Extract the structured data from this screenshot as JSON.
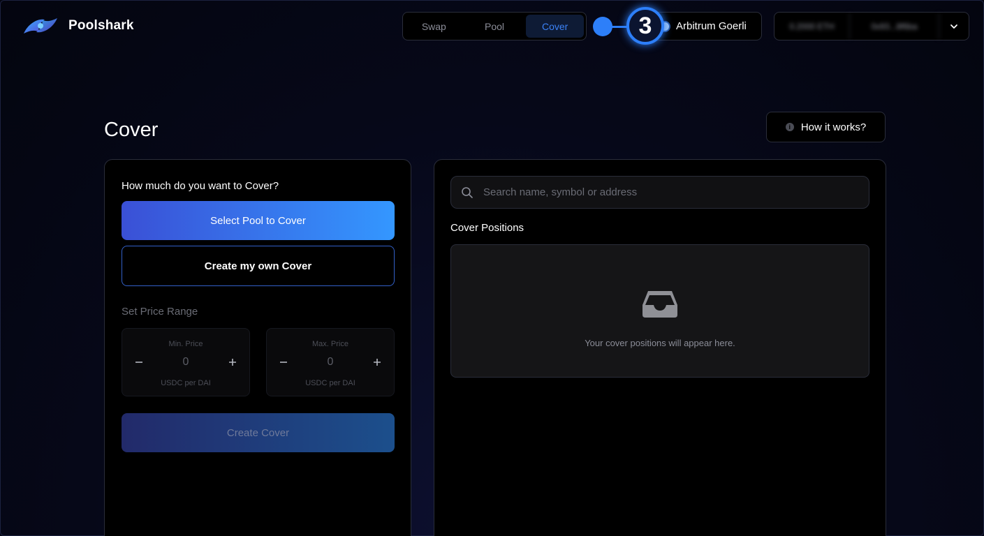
{
  "app": {
    "name": "Poolshark"
  },
  "nav": {
    "tabs": [
      {
        "label": "Swap"
      },
      {
        "label": "Pool"
      },
      {
        "label": "Cover",
        "active": true
      }
    ]
  },
  "step_badge": "3",
  "network": {
    "label": "Arbitrum Goerli"
  },
  "wallet": {
    "balance": "0.2000 ETH",
    "address": "0x93...8f6ba"
  },
  "page": {
    "title": "Cover",
    "how_it_works": "How it works?"
  },
  "left_panel": {
    "question": "How much do you want to Cover?",
    "select_pool_label": "Select Pool to Cover",
    "create_own_label": "Create my own Cover",
    "price_range_label": "Set Price Range",
    "min_price": {
      "label": "Min. Price",
      "value": "0",
      "unit": "USDC per DAI"
    },
    "max_price": {
      "label": "Max. Price",
      "value": "0",
      "unit": "USDC per DAI"
    },
    "create_cover_label": "Create Cover"
  },
  "right_panel": {
    "search_placeholder": "Search name, symbol or address",
    "positions_label": "Cover Positions",
    "empty_text": "Your cover positions will appear here."
  },
  "colors": {
    "accent": "#2d7ff9",
    "gradient_start": "#3a50d6",
    "gradient_end": "#3497ff",
    "background": "#060819"
  }
}
